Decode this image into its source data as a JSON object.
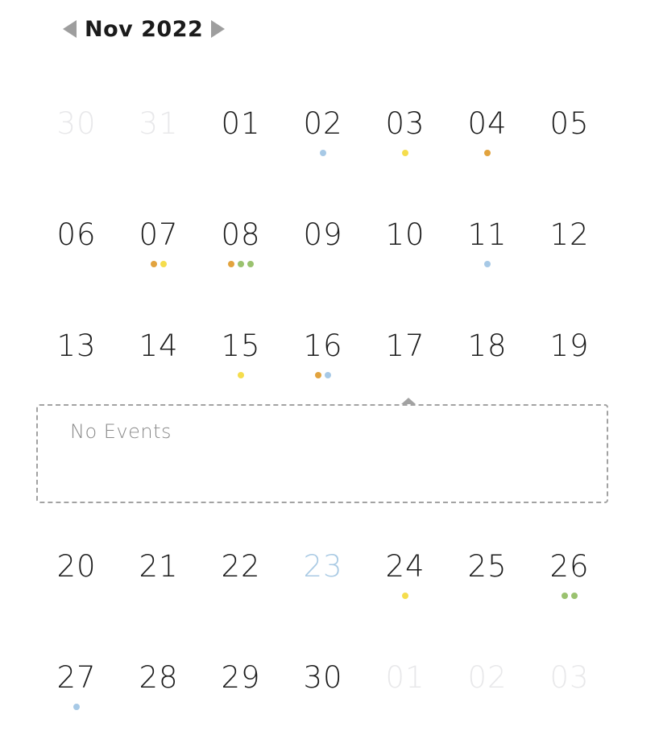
{
  "header": {
    "title": "Nov 2022",
    "prev_icon": "chevron-left-icon",
    "next_icon": "chevron-right-icon"
  },
  "colors": {
    "orange": "#e2a33e",
    "yellow": "#f5dd4d",
    "green": "#9ac26f",
    "blue": "#a7c9e6"
  },
  "weeks": [
    [
      {
        "day": "30",
        "outside": true,
        "dots": []
      },
      {
        "day": "31",
        "outside": true,
        "dots": []
      },
      {
        "day": "01",
        "dots": []
      },
      {
        "day": "02",
        "dots": [
          "blue"
        ]
      },
      {
        "day": "03",
        "dots": [
          "yellow"
        ]
      },
      {
        "day": "04",
        "dots": [
          "orange"
        ]
      },
      {
        "day": "05",
        "dots": []
      }
    ],
    [
      {
        "day": "06",
        "dots": []
      },
      {
        "day": "07",
        "dots": [
          "orange",
          "yellow"
        ]
      },
      {
        "day": "08",
        "dots": [
          "orange",
          "green",
          "green"
        ]
      },
      {
        "day": "09",
        "dots": []
      },
      {
        "day": "10",
        "dots": []
      },
      {
        "day": "11",
        "dots": [
          "blue"
        ]
      },
      {
        "day": "12",
        "dots": []
      }
    ],
    [
      {
        "day": "13",
        "dots": []
      },
      {
        "day": "14",
        "dots": []
      },
      {
        "day": "15",
        "dots": [
          "yellow"
        ]
      },
      {
        "day": "16",
        "dots": [
          "orange",
          "blue"
        ]
      },
      {
        "day": "17",
        "dots": [],
        "selected": true
      },
      {
        "day": "18",
        "dots": []
      },
      {
        "day": "19",
        "dots": []
      }
    ],
    [
      {
        "day": "20",
        "dots": []
      },
      {
        "day": "21",
        "dots": []
      },
      {
        "day": "22",
        "dots": []
      },
      {
        "day": "23",
        "dots": [],
        "today": true
      },
      {
        "day": "24",
        "dots": [
          "yellow"
        ]
      },
      {
        "day": "25",
        "dots": []
      },
      {
        "day": "26",
        "dots": [
          "green",
          "green"
        ]
      }
    ],
    [
      {
        "day": "27",
        "dots": [
          "blue"
        ]
      },
      {
        "day": "28",
        "dots": []
      },
      {
        "day": "29",
        "dots": []
      },
      {
        "day": "30",
        "dots": []
      },
      {
        "day": "01",
        "outside": true,
        "dots": []
      },
      {
        "day": "02",
        "outside": true,
        "dots": []
      },
      {
        "day": "03",
        "outside": true,
        "dots": []
      }
    ]
  ],
  "event_panel": {
    "empty_text": "No Events"
  }
}
